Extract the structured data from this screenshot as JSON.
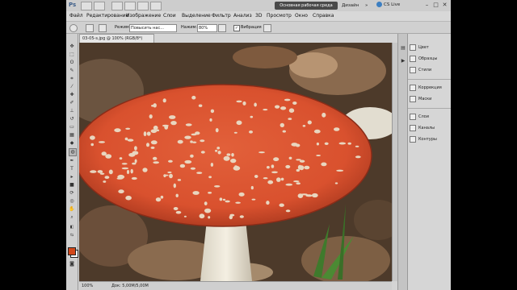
{
  "titlebar": {
    "logo": "Ps",
    "workspace_active": "Основная рабочая среда",
    "workspace_design": "Дизайн",
    "more": "»",
    "cslive": "CS Live",
    "win_minimize": "–",
    "win_maximize": "□",
    "win_close": "✕"
  },
  "menu": [
    "Файл",
    "Редактирование",
    "Изображение",
    "Слои",
    "Выделение",
    "Фильтр",
    "Анализ",
    "3D",
    "Просмотр",
    "Окно",
    "Справка"
  ],
  "options": {
    "mode_label": "Режим:",
    "mode_value": "Повысить нас...",
    "pressure_label": "Нажим:",
    "pressure_value": "80%",
    "vibrance_label": "Вибрация",
    "vibrance_checked": "✓"
  },
  "document": {
    "tab_title": "03-05-s.jpg @ 100% (RGB/8*)",
    "zoom": "100%",
    "doc_info": "Док: 5,00М/5,00М",
    "foreground_color": "#d3481a",
    "background_color": "#ffffff"
  },
  "panels": {
    "group1": [
      "Цвет",
      "Образцы",
      "Стили"
    ],
    "group2": [
      "Коррекция",
      "Маски"
    ],
    "group3": [
      "Слои",
      "Каналы",
      "Контуры"
    ]
  },
  "tools": [
    "move-icon",
    "marquee-icon",
    "lasso-icon",
    "quick-select-icon",
    "crop-icon",
    "eyedropper-icon",
    "healing-icon",
    "brush-icon",
    "clone-stamp-icon",
    "history-brush-icon",
    "eraser-icon",
    "gradient-icon",
    "blur-icon",
    "sponge-icon",
    "pen-icon",
    "type-icon",
    "path-select-icon",
    "shape-icon",
    "3d-rotate-icon",
    "3d-orbit-icon",
    "hand-icon",
    "zoom-icon"
  ]
}
